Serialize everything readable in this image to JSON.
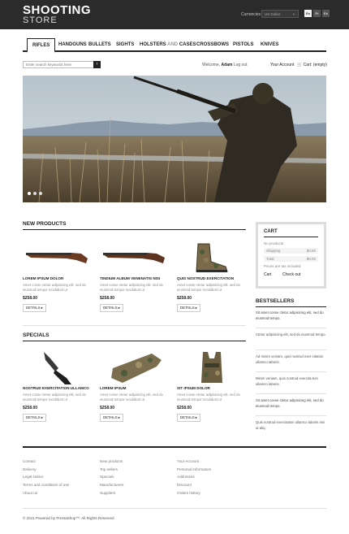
{
  "header": {
    "logo_line1": "SHOOTING",
    "logo_line2": "STORE",
    "currency_label": "Currencies",
    "currency_value": "US Dollar",
    "languages": [
      "En",
      "Fr",
      "Es"
    ]
  },
  "nav": {
    "items": [
      "RIFLES",
      "HANDGUNS",
      "BULLETS",
      "SIGHTS"
    ],
    "holsters_a": "HOLSTERS",
    "holsters_and": "AND",
    "holsters_b": "CASES",
    "items2": [
      "CROSSBOWS",
      "PISTOLS",
      "KNIVES"
    ]
  },
  "topbar": {
    "search_placeholder": "Enter search keywords here",
    "welcome": "Welcome,",
    "user": "Adam",
    "logout": "Log out",
    "account": "Your Account",
    "cart": "Cart: (empty)"
  },
  "new_products": {
    "title": "NEW PRODUCTS",
    "items": [
      {
        "name": "LOREM IPSUM DOLOR",
        "desc": "Amet conse ctetur adipisicing elit, sed do eiusmod tempor incididunt ut",
        "price": "$258.00",
        "details": "DETAILS"
      },
      {
        "name": "TINDIUM ALBUM VENENATIS NISI",
        "desc": "Amet conse ctetur adipisicing elit, sed do eiusmod tempor incididunt ut",
        "price": "$258.00",
        "details": "DETAILS"
      },
      {
        "name": "QUIS NOSTRUD EXERCITATION",
        "desc": "Amet conse ctetur adipisicing elit, sed do eiusmod tempor incididunt ut",
        "price": "$258.00",
        "details": "DETAILS"
      }
    ]
  },
  "specials": {
    "title": "SPECIALS",
    "items": [
      {
        "name": "NOSTRUD EXERCITATION ULLAMCO",
        "desc": "Amet conse ctetur adipisicing elit, sed do eiusmod tempor incididunt ut",
        "price": "$258.00",
        "details": "DETAILS"
      },
      {
        "name": "LOREM IPSUM",
        "desc": "Amet conse ctetur adipisicing elit, sed do eiusmod tempor incididunt ut",
        "price": "$258.00",
        "details": "DETAILS"
      },
      {
        "name": "SIT IPSUM DOLOR",
        "desc": "Amet conse ctetur adipisicing elit, sed do eiusmod tempor incididunt ut",
        "price": "$258.00",
        "details": "DETAILS"
      }
    ]
  },
  "cart": {
    "title": "CART",
    "empty": "No products",
    "shipping_label": "Shipping",
    "shipping_value": "$0.00",
    "total_label": "Total",
    "total_value": "$0.00",
    "tax_note": "Prices are tax included",
    "cart_btn": "Cart",
    "checkout_btn": "Check out"
  },
  "bestsellers": {
    "title": "BESTSELLERS",
    "items": [
      "Sit amet conse ctetur adipisicing elit, sed do eiusmod tempo.",
      "Ctetur adipisicing elit, sed do eiusmod tempo.",
      "Ad minim veniam, quis nostrud exer-citation ullamco laboris.",
      "Minim veniam, quis nostrud exercita-tion ullamco laboris.",
      "Sit amet conse ctetur adipisicing elit, sed do eiusmod tempo.",
      "Quis nostrud exercitation ullamco laboris nisi ut aliq."
    ]
  },
  "footer": {
    "col1": [
      "Contact",
      "Delivery",
      "Legal Notice",
      "Terms and conditions of use",
      "About us"
    ],
    "col2": [
      "New products",
      "Top sellers",
      "Specials",
      "Manufacturers",
      "Suppliers"
    ],
    "col3": [
      "Your Account",
      "Personal information",
      "Addresses",
      "Discount",
      "Orders history"
    ],
    "copyright": "© 2011 Powered by PrestaShop™. All Rights Reserved"
  },
  "colors": {
    "header_bg": "#2b2b2b",
    "accent": "#222222"
  }
}
